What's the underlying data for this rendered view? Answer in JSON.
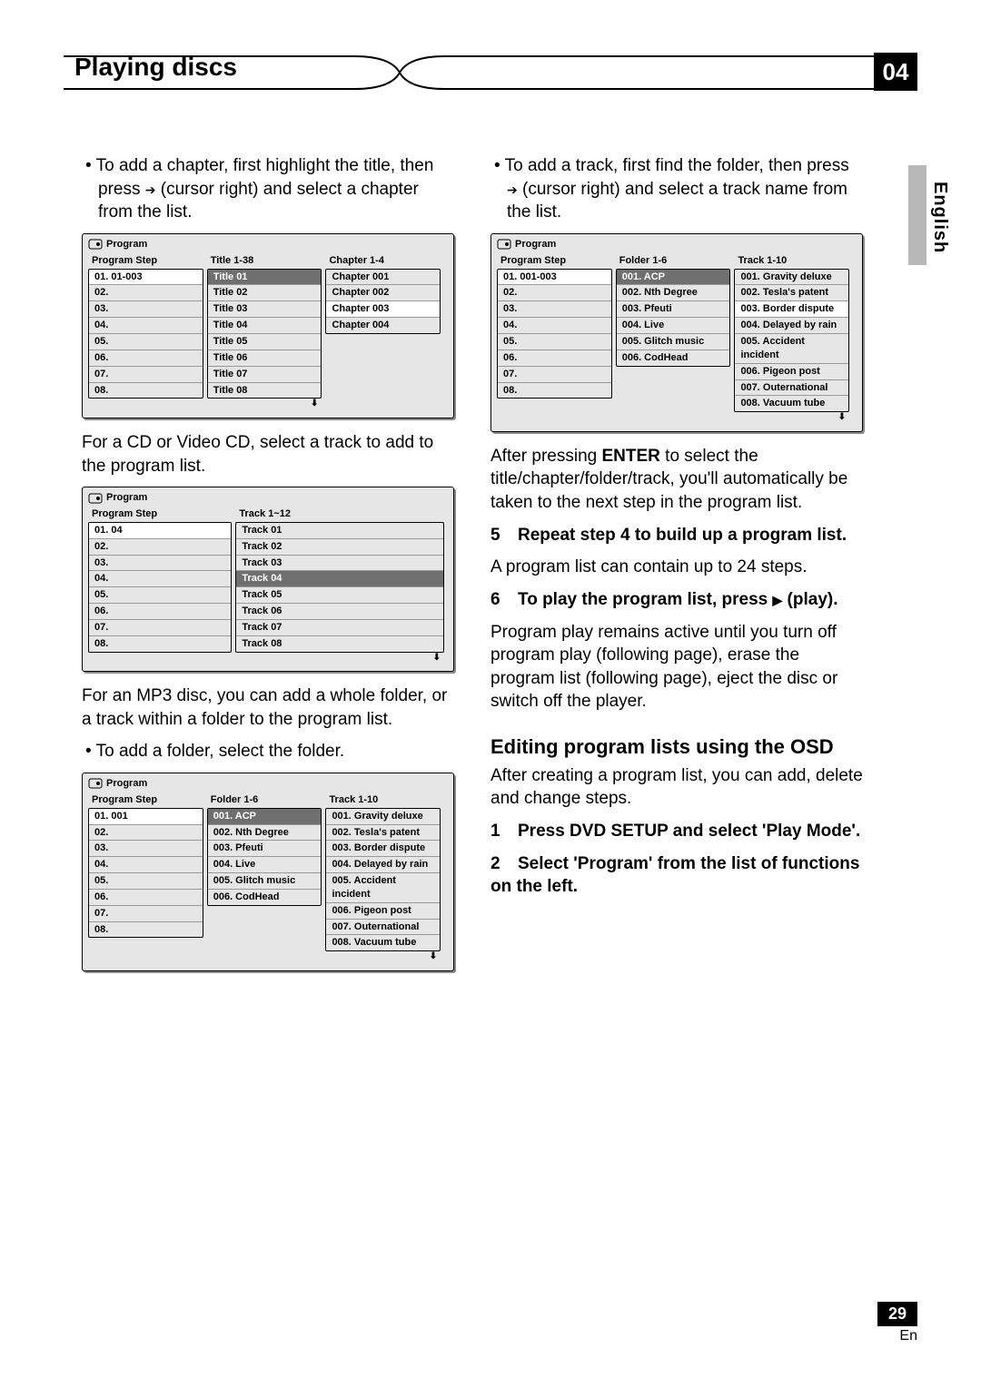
{
  "chapter_num": "04",
  "chapter_title": "Playing discs",
  "side_lang": "English",
  "page_number": "29",
  "page_lang": "En",
  "left": {
    "bullet1_a": "To add a chapter, first highlight the title, then press ",
    "bullet1_b": " (cursor right) and select a chapter from the list.",
    "para1": "For a CD or Video CD, select a track to add to the program list.",
    "para2": "For an MP3 disc, you can add a whole folder, or a track within a folder to the program list.",
    "bullet2": "To add a folder, select the folder."
  },
  "right": {
    "bullet1_a": "To add a track, first find the folder, then press ",
    "bullet1_b": " (cursor right) and select a track name from the list.",
    "para1_a": "After pressing ",
    "para1_enter": "ENTER",
    "para1_b": " to select the title/chapter/folder/track, you'll automatically be taken to the next step in the program list.",
    "step5_title": "Repeat step 4 to build up a program list.",
    "step5_body": "A program list can contain up to 24 steps.",
    "step6_title_a": "To play the program list, press ",
    "step6_title_b": " (play).",
    "step6_body": "Program play remains active until you turn off program play (following page), erase the program list (following page), eject the disc or switch off the player.",
    "section_h": "Editing program lists using the OSD",
    "section_p": "After creating a program list, you can add, delete and change steps.",
    "edit_step1": "Press DVD SETUP and select 'Play Mode'.",
    "edit_step2": "Select 'Program' from the list of functions on the left."
  },
  "osd_label": "Program",
  "osd1": {
    "h1": "Program Step",
    "h2": "Title 1-38",
    "h3": "Chapter 1-4",
    "steps": [
      "01. 01-003",
      "02.",
      "03.",
      "04.",
      "05.",
      "06.",
      "07.",
      "08."
    ],
    "titles": [
      "Title 01",
      "Title 02",
      "Title 03",
      "Title 04",
      "Title 05",
      "Title 06",
      "Title 07",
      "Title 08"
    ],
    "chapters": [
      "Chapter 001",
      "Chapter 002",
      "Chapter 003",
      "Chapter 004"
    ]
  },
  "osd2": {
    "h1": "Program Step",
    "h2": "Track 1~12",
    "steps": [
      "01. 04",
      "02.",
      "03.",
      "04.",
      "05.",
      "06.",
      "07.",
      "08."
    ],
    "tracks": [
      "Track 01",
      "Track 02",
      "Track 03",
      "Track 04",
      "Track 05",
      "Track 06",
      "Track 07",
      "Track 08"
    ]
  },
  "osd3": {
    "h1": "Program Step",
    "h2": "Folder 1-6",
    "h3": "Track 1-10",
    "steps": [
      "01. 001",
      "02.",
      "03.",
      "04.",
      "05.",
      "06.",
      "07.",
      "08."
    ],
    "folders": [
      "001. ACP",
      "002. Nth Degree",
      "003. Pfeuti",
      "004. Live",
      "005. Glitch music",
      "006. CodHead"
    ],
    "tracks": [
      "001. Gravity deluxe",
      "002. Tesla's patent",
      "003. Border dispute",
      "004. Delayed by rain",
      "005. Accident incident",
      "006. Pigeon post",
      "007. Outernational",
      "008. Vacuum tube"
    ]
  },
  "osd4": {
    "h1": "Program Step",
    "h2": "Folder 1-6",
    "h3": "Track 1-10",
    "steps": [
      "01. 001-003",
      "02.",
      "03.",
      "04.",
      "05.",
      "06.",
      "07.",
      "08."
    ],
    "folders": [
      "001. ACP",
      "002. Nth Degree",
      "003. Pfeuti",
      "004. Live",
      "005. Glitch music",
      "006. CodHead"
    ],
    "tracks": [
      "001. Gravity deluxe",
      "002. Tesla's patent",
      "003. Border dispute",
      "004. Delayed by rain",
      "005. Accident incident",
      "006. Pigeon post",
      "007. Outernational",
      "008. Vacuum tube"
    ]
  }
}
